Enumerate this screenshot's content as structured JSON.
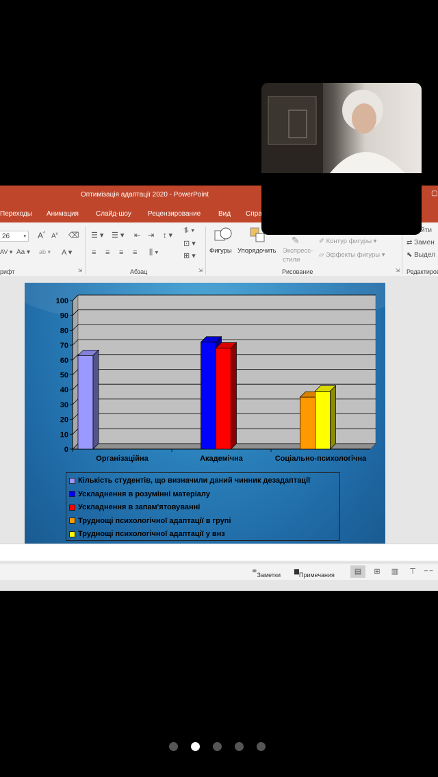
{
  "window": {
    "title": "Оптимізація адаптації 2020  -  PowerPoint"
  },
  "tabs": [
    "Переходы",
    "Анимация",
    "Слайд-шоу",
    "Рецензирование",
    "Вид",
    "Спра"
  ],
  "ribbon": {
    "font_size": "26",
    "groups": {
      "font": "рифт",
      "paragraph": "Абзац",
      "drawing": "Рисование",
      "editing": "Редактиров"
    },
    "shapes_label": "Фигуры",
    "arrange_label": "Упорядочить",
    "quick_styles_label": "Экспресс-стили",
    "outline_label": "Контур фигуры",
    "effects_label": "Эффекты фигуры",
    "find_label": "Найти",
    "replace_label": "Замен",
    "select_label": "Выдел"
  },
  "status": {
    "notes": "Заметки",
    "comments": "Примечания"
  },
  "pager": {
    "count": 5,
    "active": 1
  },
  "colors": {
    "title_bar": "#c0462b",
    "slide_bg": "#2d86c0",
    "plot_bg": "#c0c0c0"
  },
  "chart_data": {
    "type": "bar",
    "categories": [
      "Організаційна",
      "Академічна",
      "Соціально-психологічна"
    ],
    "ylim": [
      0,
      100
    ],
    "yticks": [
      0,
      10,
      20,
      30,
      40,
      50,
      60,
      70,
      80,
      90,
      100
    ],
    "grid": true,
    "legend_position": "bottom",
    "series": [
      {
        "name": "Кількість студентів, що визначили даний чинник дезадаптації",
        "color": "#9999ff",
        "values": [
          63,
          null,
          null
        ]
      },
      {
        "name": "Ускладнення в розумінні матеріалу",
        "color": "#0000ff",
        "values": [
          null,
          72,
          null
        ]
      },
      {
        "name": "Ускладнення в запам'ятовуванні",
        "color": "#ff0000",
        "values": [
          null,
          68,
          null
        ]
      },
      {
        "name": "Труднощі психологічної адаптації в групі",
        "color": "#ff9900",
        "values": [
          null,
          null,
          35
        ]
      },
      {
        "name": "Труднощі психологічної адаптації у внз",
        "color": "#ffff00",
        "values": [
          null,
          null,
          39
        ]
      }
    ]
  }
}
